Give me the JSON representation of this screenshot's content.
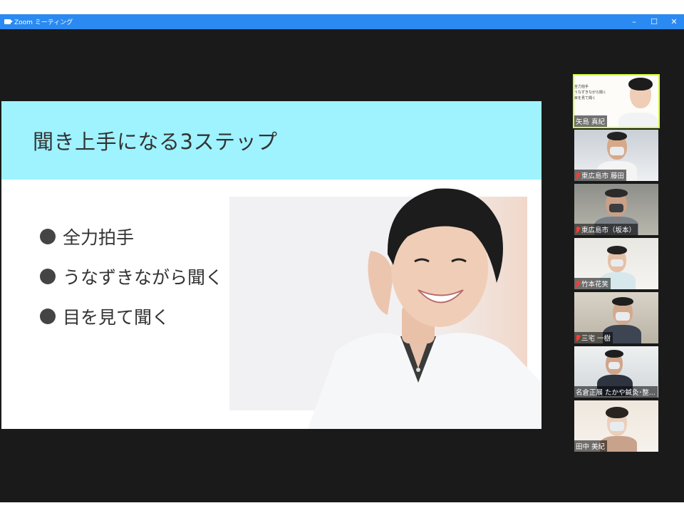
{
  "window": {
    "title": "Zoom ミーティング",
    "controls": {
      "minimize": "–",
      "maximize": "☐",
      "close": "✕"
    }
  },
  "slide": {
    "title": "聞き上手になる3ステップ",
    "bullets": [
      "全力拍手",
      "うなずきながら聞く",
      "目を見て聞く"
    ],
    "header_color": "#9ef3ff"
  },
  "gallery": {
    "participants": [
      {
        "name": "矢島 真紀",
        "muted": false,
        "active": true
      },
      {
        "name": "東広島市 藤田",
        "muted": true,
        "active": false
      },
      {
        "name": "東広島市（坂本）",
        "muted": true,
        "active": false
      },
      {
        "name": "竹本花笑",
        "muted": true,
        "active": false
      },
      {
        "name": "三宅 一樹",
        "muted": true,
        "active": false
      },
      {
        "name": "名倉正展 たかや鍼灸･整...",
        "muted": false,
        "active": false
      },
      {
        "name": "田中 美紀",
        "muted": false,
        "active": false
      }
    ],
    "mini_slide_lines": [
      "全力拍手",
      "うなずきながら聞く",
      "目を見て聞く"
    ]
  },
  "colors": {
    "titlebar": "#2b8af2",
    "background": "#1a1a1a",
    "active_speaker_border": "#d4ff3f",
    "muted_icon": "#ff3b30"
  }
}
